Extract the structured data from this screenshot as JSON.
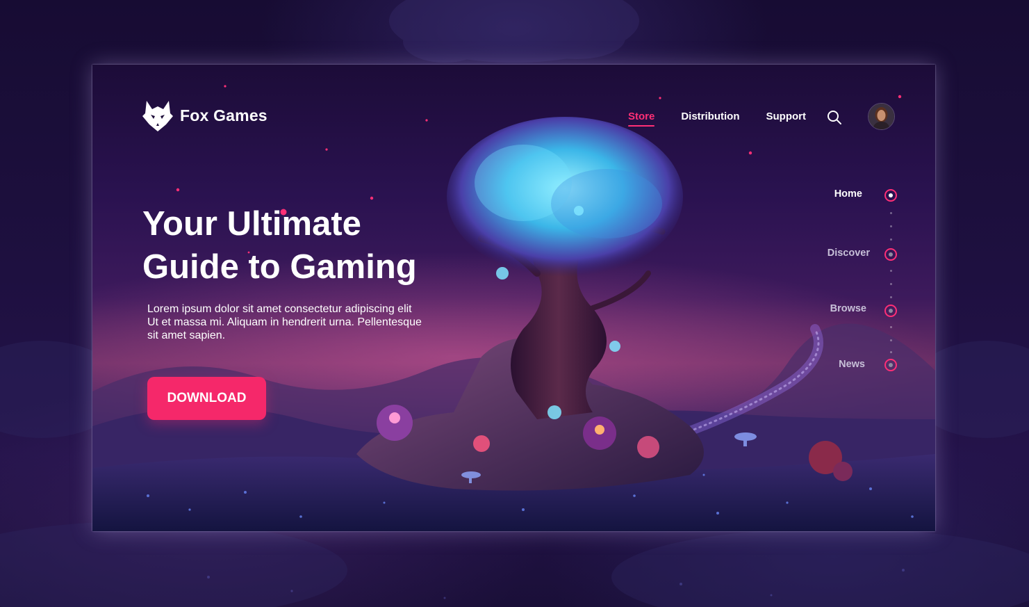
{
  "brand": {
    "name": "Fox Games",
    "logo_icon": "fox-head-icon"
  },
  "nav": {
    "items": [
      {
        "label": "Store",
        "active": true
      },
      {
        "label": "Distribution",
        "active": false
      },
      {
        "label": "Support",
        "active": false
      }
    ],
    "search_icon": "search-icon",
    "avatar": "user-avatar"
  },
  "hero": {
    "headline_line1": "Your Ultimate",
    "headline_line2": "Guide to Gaming",
    "body": "Lorem ipsum dolor sit amet consectetur adipiscing elit Ut et massa mi. Aliquam in hendrerit urna. Pellentesque sit amet sapien.",
    "cta_label": "DOWNLOAD"
  },
  "side_nav": {
    "items": [
      {
        "label": "Home",
        "active": true
      },
      {
        "label": "Discover",
        "active": false
      },
      {
        "label": "Browse",
        "active": false
      },
      {
        "label": "News",
        "active": false
      }
    ]
  },
  "colors": {
    "accent": "#f5286a",
    "nav_active": "#ff2f76",
    "background": "#1e1040"
  }
}
